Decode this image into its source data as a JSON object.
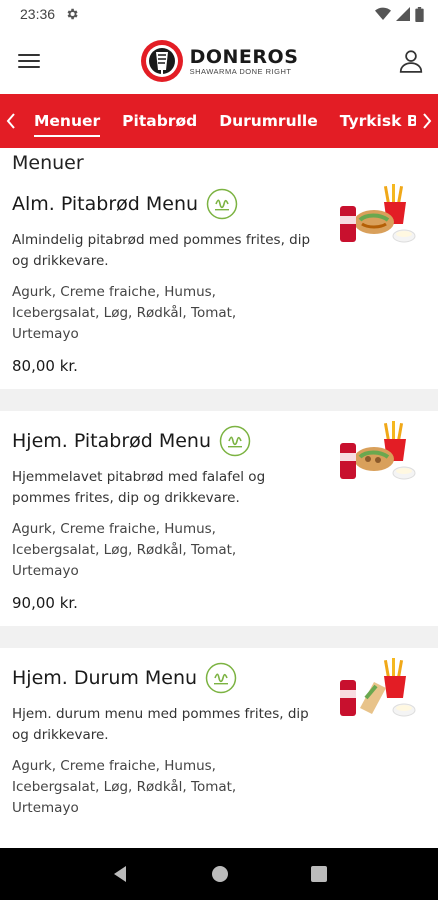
{
  "status": {
    "time": "23:36"
  },
  "brand": {
    "name": "DONEROS",
    "tagline": "SHAWARMA DONE RIGHT"
  },
  "categories": [
    "Menuer",
    "Pitabrød",
    "Durumrulle",
    "Tyrkisk Brød"
  ],
  "section_title": "Menuer",
  "items": [
    {
      "name": "Alm. Pitabrød Menu",
      "description": "Almindelig pitabrød med pommes frites, dip og drikkevare.",
      "ingredients": "Agurk, Creme fraiche, Humus, Icebergsalat, Løg, Rødkål, Tomat, Urtemayo",
      "price": "80,00 kr."
    },
    {
      "name": "Hjem. Pitabrød Menu",
      "description": "Hjemmelavet pitabrød med falafel og pommes frites, dip og drikkevare.",
      "ingredients": "Agurk, Creme fraiche, Humus, Icebergsalat, Løg, Rødkål, Tomat, Urtemayo",
      "price": "90,00 kr."
    },
    {
      "name": "Hjem. Durum Menu",
      "description": "Hjem. durum menu med pommes frites, dip og drikkevare.",
      "ingredients": "Agurk, Creme fraiche, Humus, Icebergsalat, Løg, Rødkål, Tomat, Urtemayo",
      "price": ""
    }
  ],
  "colors": {
    "accent": "#e31d25",
    "halal": "#7cb342"
  },
  "icons": [
    "gear-icon",
    "wifi-icon",
    "signal-icon",
    "battery-icon",
    "hamburger-menu-icon",
    "profile-icon",
    "chevron-left-icon",
    "chevron-right-icon",
    "halal-icon",
    "back-icon",
    "home-icon",
    "recents-icon"
  ]
}
